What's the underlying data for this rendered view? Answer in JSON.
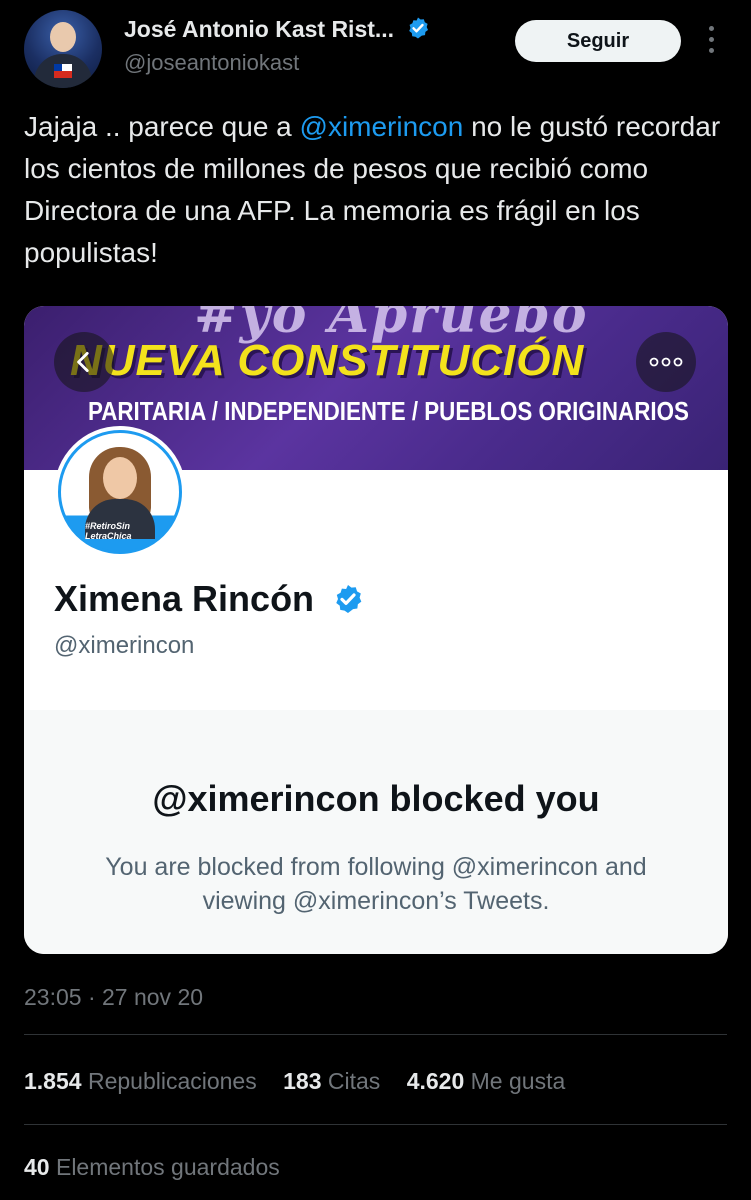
{
  "author": {
    "name": "José Antonio Kast Rist...",
    "handle": "@joseantoniokast"
  },
  "follow_label": "Seguir",
  "tweet": {
    "text_before": "Jajaja .. parece que a ",
    "mention": "@ximerincon",
    "text_after": " no le gustó recordar los cientos de millones de pesos que recibió como Directora de una AFP. La memoria es frágil en los populistas!"
  },
  "card": {
    "banner_title": "NUEVA CONSTITUCIÓN",
    "banner_subtitle": "PARITARIA / INDEPENDIENTE / PUEBLOS ORIGINARIOS",
    "profile_tag": "#RetiroSin LetraChica",
    "profile_name": "Ximena Rincón",
    "profile_handle": "@ximerincon",
    "blocked_title": "@ximerincon blocked you",
    "blocked_desc": "You are blocked from following @ximerincon and viewing @ximerincon’s Tweets."
  },
  "timestamp": "23:05 · 27 nov 20",
  "stats": {
    "reposts_count": "1.854",
    "reposts_label": "Republicaciones",
    "quotes_count": "183",
    "quotes_label": "Citas",
    "likes_count": "4.620",
    "likes_label": "Me gusta",
    "bookmarks_count": "40",
    "bookmarks_label": "Elementos guardados"
  },
  "colors": {
    "background": "#000000",
    "link": "#1d9bf0",
    "verified": "#1d9bf0",
    "banner_title": "#f3e21c",
    "banner_bg": "#4a2b8c"
  },
  "icons": [
    "verified-badge-icon",
    "more-vertical-icon",
    "chevron-left-icon",
    "more-horizontal-icon"
  ]
}
